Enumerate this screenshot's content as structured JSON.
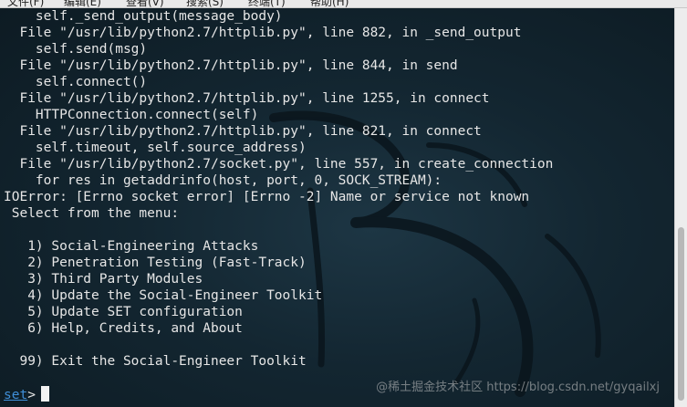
{
  "menu": {
    "items": [
      "文件(F)",
      "编辑(E)",
      "查看(V)",
      "搜索(S)",
      "终端(T)",
      "帮助(H)"
    ]
  },
  "terminal": {
    "lines": [
      "    self._send_output(message_body)",
      "  File \"/usr/lib/python2.7/httplib.py\", line 882, in _send_output",
      "    self.send(msg)",
      "  File \"/usr/lib/python2.7/httplib.py\", line 844, in send",
      "    self.connect()",
      "  File \"/usr/lib/python2.7/httplib.py\", line 1255, in connect",
      "    HTTPConnection.connect(self)",
      "  File \"/usr/lib/python2.7/httplib.py\", line 821, in connect",
      "    self.timeout, self.source_address)",
      "  File \"/usr/lib/python2.7/socket.py\", line 557, in create_connection",
      "    for res in getaddrinfo(host, port, 0, SOCK_STREAM):",
      "IOError: [Errno socket error] [Errno -2] Name or service not known",
      " Select from the menu:",
      "",
      "   1) Social-Engineering Attacks",
      "   2) Penetration Testing (Fast-Track)",
      "   3) Third Party Modules",
      "   4) Update the Social-Engineer Toolkit",
      "   5) Update SET configuration",
      "   6) Help, Credits, and About",
      "",
      "  99) Exit the Social-Engineer Toolkit",
      ""
    ],
    "prompt": "set",
    "prompt_symbol": ">"
  },
  "watermark": "@稀土掘金技术社区 https://blog.csdn.net/gyqailxj",
  "colors": {
    "background": "#132631",
    "text": "#e6e6e6",
    "prompt": "#3f8fd8"
  }
}
